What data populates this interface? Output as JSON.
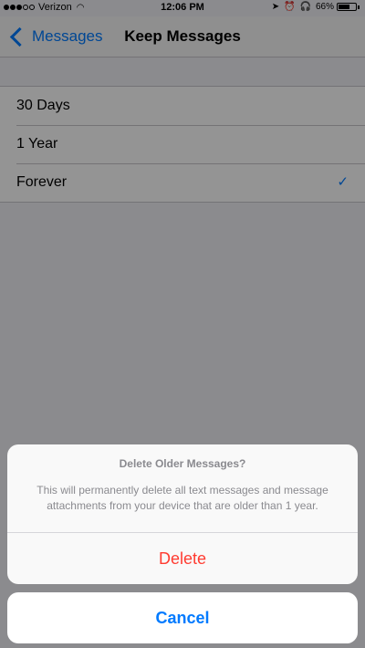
{
  "status_bar": {
    "carrier": "Verizon",
    "time": "12:06 PM",
    "battery": "66%",
    "battery_level": 0.66
  },
  "nav": {
    "back_label": "Messages",
    "title": "Keep Messages"
  },
  "options": [
    {
      "label": "30 Days",
      "selected": false
    },
    {
      "label": "1 Year",
      "selected": false
    },
    {
      "label": "Forever",
      "selected": true
    }
  ],
  "checkmark_glyph": "✓",
  "action_sheet": {
    "title": "Delete Older Messages?",
    "message": "This will permanently delete all text messages and message attachments from your device that are older than 1 year.",
    "delete_label": "Delete",
    "cancel_label": "Cancel"
  },
  "colors": {
    "accent": "#007aff",
    "destructive": "#ff3b30"
  },
  "icons": [
    "signal-icon",
    "wifi-icon",
    "location-icon",
    "alarm-icon",
    "headphones-icon",
    "battery-icon",
    "chevron-left-icon",
    "checkmark-icon"
  ]
}
